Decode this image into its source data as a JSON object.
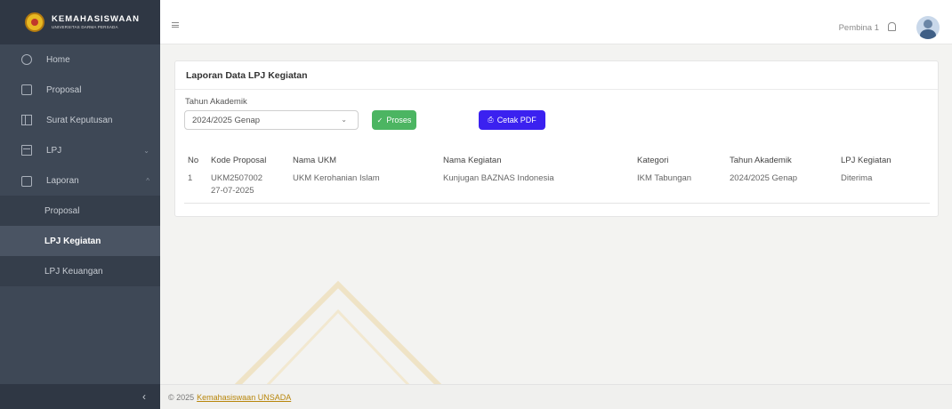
{
  "brand": {
    "title": "KEMAHASISWAAN",
    "subtitle": "UNIVERSITAS DARMA PERSADA"
  },
  "sidebar": {
    "items": [
      {
        "label": "Home",
        "icon": "home-icon"
      },
      {
        "label": "Proposal",
        "icon": "document-icon"
      },
      {
        "label": "Surat Keputusan",
        "icon": "grid-icon"
      },
      {
        "label": "LPJ",
        "icon": "book-icon",
        "chevron": "⌄"
      },
      {
        "label": "Laporan",
        "icon": "print-icon",
        "chevron": "^"
      }
    ],
    "submenu": [
      {
        "label": "Proposal"
      },
      {
        "label": "LPJ Kegiatan",
        "active": true
      },
      {
        "label": "LPJ Keuangan"
      }
    ],
    "collapse": "‹"
  },
  "header": {
    "user_name": "Pembina 1"
  },
  "card": {
    "title": "Laporan Data LPJ Kegiatan",
    "form_label": "Tahun Akademik",
    "select_value": "2024/2025 Genap",
    "btn_proses": "Proses",
    "btn_pdf": "Cetak PDF"
  },
  "table": {
    "columns": [
      "No",
      "Kode Proposal",
      "Nama UKM",
      "Nama Kegiatan",
      "Kategori",
      "Tahun Akademik",
      "LPJ Kegiatan"
    ],
    "rows": [
      {
        "no": "1",
        "kode": "UKM2507002",
        "tanggal": "27-07-2025",
        "ukm": "UKM Kerohanian Islam",
        "kegiatan": "Kunjugan BAZNAS Indonesia",
        "kategori": "IKM Tabungan",
        "tahun": "2024/2025 Genap",
        "status": "Diterima"
      }
    ]
  },
  "footer": {
    "copyright": "© 2025",
    "link": "Kemahasiswaan UNSADA"
  },
  "colors": {
    "sidebar": "#3e4856",
    "proses": "#4cb562",
    "pdf": "#3b21f0",
    "link": "#b8860b"
  }
}
